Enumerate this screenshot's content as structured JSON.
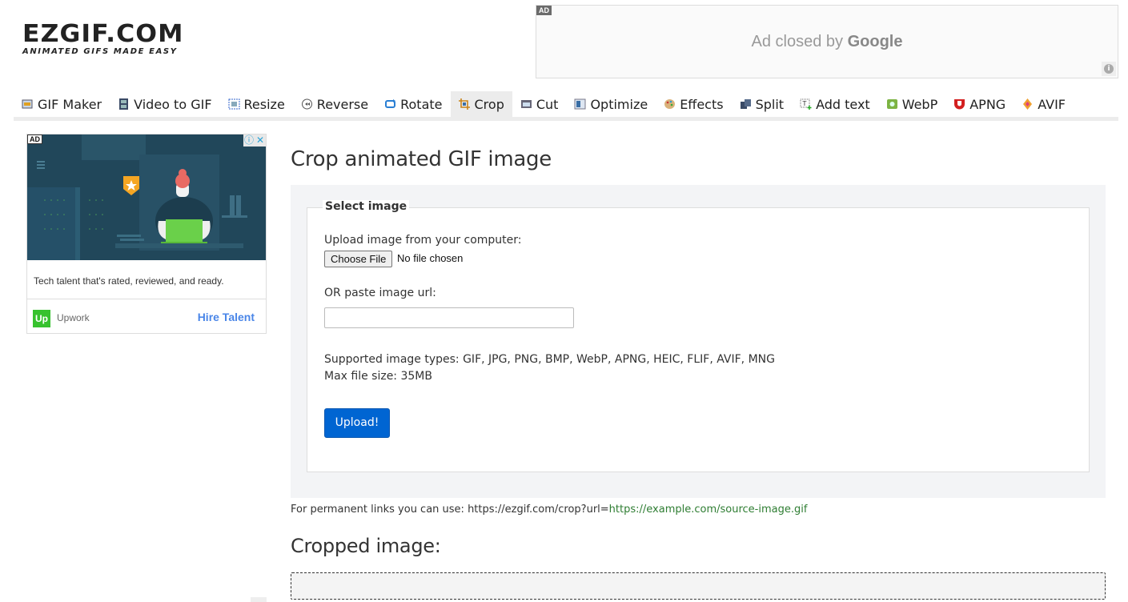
{
  "logo": {
    "main": "EZGIF.COM",
    "tagline": "ANIMATED GIFS MADE EASY"
  },
  "top_ad": {
    "badge": "AD",
    "closed_text": "Ad closed by",
    "closed_brand": "Google",
    "info_icon": "i"
  },
  "nav": {
    "items": [
      {
        "label": "GIF Maker",
        "icon": "gif-maker-icon",
        "active": false
      },
      {
        "label": "Video to GIF",
        "icon": "film-icon",
        "active": false
      },
      {
        "label": "Resize",
        "icon": "resize-icon",
        "active": false
      },
      {
        "label": "Reverse",
        "icon": "reverse-icon",
        "active": false
      },
      {
        "label": "Rotate",
        "icon": "rotate-icon",
        "active": false
      },
      {
        "label": "Crop",
        "icon": "crop-icon",
        "active": true
      },
      {
        "label": "Cut",
        "icon": "cut-icon",
        "active": false
      },
      {
        "label": "Optimize",
        "icon": "optimize-icon",
        "active": false
      },
      {
        "label": "Effects",
        "icon": "palette-icon",
        "active": false
      },
      {
        "label": "Split",
        "icon": "split-icon",
        "active": false
      },
      {
        "label": "Add text",
        "icon": "add-text-icon",
        "active": false
      },
      {
        "label": "WebP",
        "icon": "webp-icon",
        "active": false
      },
      {
        "label": "APNG",
        "icon": "apng-icon",
        "active": false
      },
      {
        "label": "AVIF",
        "icon": "avif-icon",
        "active": false
      }
    ]
  },
  "side_ad": {
    "badge": "AD",
    "info": "ⓘ",
    "close": "✕",
    "text": "Tech talent that's rated, reviewed, and ready.",
    "brand_logo": "Up",
    "brand": "Upwork",
    "cta": "Hire Talent"
  },
  "main": {
    "title": "Crop animated GIF image",
    "legend": "Select image",
    "upload_label": "Upload image from your computer:",
    "choose_file": "Choose File",
    "no_file": "No file chosen",
    "url_label": "OR paste image url:",
    "url_value": "",
    "supported": "Supported image types: GIF, JPG, PNG, BMP, WebP, APNG, HEIC, FLIF, AVIF, MNG",
    "max_size": "Max file size: 35MB",
    "upload_button": "Upload!",
    "perm_prefix": "For permanent links you can use: https://ezgif.com/crop?url=",
    "perm_example": "https://example.com/source-image.gif",
    "cropped_title": "Cropped image:"
  }
}
